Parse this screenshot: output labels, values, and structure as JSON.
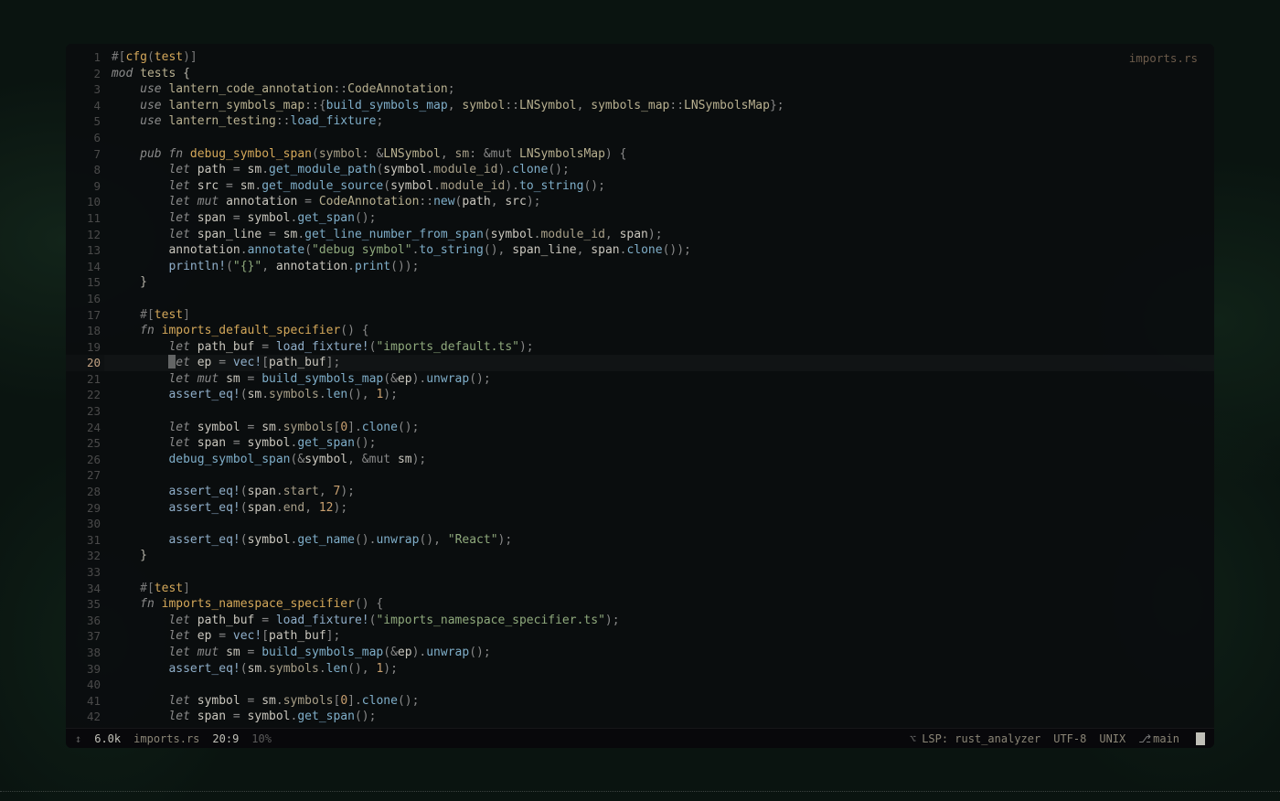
{
  "file": {
    "name": "imports.rs"
  },
  "status": {
    "left": {
      "arrow": "↕",
      "size": "6.0k",
      "filename": "imports.rs",
      "position": "20:9",
      "percent": "10%"
    },
    "center": {
      "prefix": "⌥",
      "lsp": "LSP: rust_analyzer"
    },
    "right": {
      "encoding": "UTF-8",
      "lineending": "UNIX",
      "branch_icon": "⎇",
      "branch": "main"
    }
  },
  "active_line": 20,
  "lines": [
    {
      "n": 1,
      "tokens": [
        [
          "t-attr",
          "#["
        ],
        [
          "t-built",
          "cfg"
        ],
        [
          "t-attr",
          "("
        ],
        [
          "t-built",
          "test"
        ],
        [
          "t-attr",
          ")]"
        ]
      ]
    },
    {
      "n": 2,
      "tokens": [
        [
          "t-kw",
          "mod "
        ],
        [
          "t-type",
          "tests"
        ],
        [
          "t-plain",
          " {"
        ]
      ]
    },
    {
      "n": 3,
      "tokens": [
        [
          "t-kw",
          "    use "
        ],
        [
          "t-path",
          "lantern_code_annotation"
        ],
        [
          "t-op",
          "::"
        ],
        [
          "t-type",
          "CodeAnnotation"
        ],
        [
          "t-punct",
          ";"
        ]
      ]
    },
    {
      "n": 4,
      "tokens": [
        [
          "t-kw",
          "    use "
        ],
        [
          "t-path",
          "lantern_symbols_map"
        ],
        [
          "t-op",
          "::{"
        ],
        [
          "t-func",
          "build_symbols_map"
        ],
        [
          "t-punct",
          ", "
        ],
        [
          "t-path",
          "symbol"
        ],
        [
          "t-op",
          "::"
        ],
        [
          "t-type",
          "LNSymbol"
        ],
        [
          "t-punct",
          ", "
        ],
        [
          "t-path",
          "symbols_map"
        ],
        [
          "t-op",
          "::"
        ],
        [
          "t-type",
          "LNSymbolsMap"
        ],
        [
          "t-punct",
          "};"
        ]
      ]
    },
    {
      "n": 5,
      "tokens": [
        [
          "t-kw",
          "    use "
        ],
        [
          "t-path",
          "lantern_testing"
        ],
        [
          "t-op",
          "::"
        ],
        [
          "t-func",
          "load_fixture"
        ],
        [
          "t-punct",
          ";"
        ]
      ]
    },
    {
      "n": 6,
      "tokens": []
    },
    {
      "n": 7,
      "tokens": [
        [
          "t-kw",
          "    pub fn "
        ],
        [
          "t-funcdef",
          "debug_symbol_span"
        ],
        [
          "t-punct",
          "("
        ],
        [
          "t-param",
          "symbol"
        ],
        [
          "t-punct",
          ": "
        ],
        [
          "t-op",
          "&"
        ],
        [
          "t-type",
          "LNSymbol"
        ],
        [
          "t-punct",
          ", "
        ],
        [
          "t-param",
          "sm"
        ],
        [
          "t-punct",
          ": "
        ],
        [
          "t-op",
          "&mut "
        ],
        [
          "t-type",
          "LNSymbolsMap"
        ],
        [
          "t-punct",
          ") {"
        ]
      ]
    },
    {
      "n": 8,
      "tokens": [
        [
          "t-kw",
          "        let "
        ],
        [
          "t-var",
          "path"
        ],
        [
          "t-op",
          " = "
        ],
        [
          "t-var",
          "sm"
        ],
        [
          "t-punct",
          "."
        ],
        [
          "t-func",
          "get_module_path"
        ],
        [
          "t-punct",
          "("
        ],
        [
          "t-var",
          "symbol"
        ],
        [
          "t-punct",
          "."
        ],
        [
          "t-prop",
          "module_id"
        ],
        [
          "t-punct",
          ")."
        ],
        [
          "t-func",
          "clone"
        ],
        [
          "t-punct",
          "();"
        ]
      ]
    },
    {
      "n": 9,
      "tokens": [
        [
          "t-kw",
          "        let "
        ],
        [
          "t-var",
          "src"
        ],
        [
          "t-op",
          " = "
        ],
        [
          "t-var",
          "sm"
        ],
        [
          "t-punct",
          "."
        ],
        [
          "t-func",
          "get_module_source"
        ],
        [
          "t-punct",
          "("
        ],
        [
          "t-var",
          "symbol"
        ],
        [
          "t-punct",
          "."
        ],
        [
          "t-prop",
          "module_id"
        ],
        [
          "t-punct",
          ")."
        ],
        [
          "t-func",
          "to_string"
        ],
        [
          "t-punct",
          "();"
        ]
      ]
    },
    {
      "n": 10,
      "tokens": [
        [
          "t-kw",
          "        let mut "
        ],
        [
          "t-var",
          "annotation"
        ],
        [
          "t-op",
          " = "
        ],
        [
          "t-type",
          "CodeAnnotation"
        ],
        [
          "t-op",
          "::"
        ],
        [
          "t-func",
          "new"
        ],
        [
          "t-punct",
          "("
        ],
        [
          "t-var",
          "path"
        ],
        [
          "t-punct",
          ", "
        ],
        [
          "t-var",
          "src"
        ],
        [
          "t-punct",
          ");"
        ]
      ]
    },
    {
      "n": 11,
      "tokens": [
        [
          "t-kw",
          "        let "
        ],
        [
          "t-var",
          "span"
        ],
        [
          "t-op",
          " = "
        ],
        [
          "t-var",
          "symbol"
        ],
        [
          "t-punct",
          "."
        ],
        [
          "t-func",
          "get_span"
        ],
        [
          "t-punct",
          "();"
        ]
      ]
    },
    {
      "n": 12,
      "tokens": [
        [
          "t-kw",
          "        let "
        ],
        [
          "t-var",
          "span_line"
        ],
        [
          "t-op",
          " = "
        ],
        [
          "t-var",
          "sm"
        ],
        [
          "t-punct",
          "."
        ],
        [
          "t-func",
          "get_line_number_from_span"
        ],
        [
          "t-punct",
          "("
        ],
        [
          "t-var",
          "symbol"
        ],
        [
          "t-punct",
          "."
        ],
        [
          "t-prop",
          "module_id"
        ],
        [
          "t-punct",
          ", "
        ],
        [
          "t-var",
          "span"
        ],
        [
          "t-punct",
          ");"
        ]
      ]
    },
    {
      "n": 13,
      "tokens": [
        [
          "t-plain",
          "        "
        ],
        [
          "t-var",
          "annotation"
        ],
        [
          "t-punct",
          "."
        ],
        [
          "t-func",
          "annotate"
        ],
        [
          "t-punct",
          "("
        ],
        [
          "t-str",
          "\"debug symbol\""
        ],
        [
          "t-punct",
          "."
        ],
        [
          "t-func",
          "to_string"
        ],
        [
          "t-punct",
          "(), "
        ],
        [
          "t-var",
          "span_line"
        ],
        [
          "t-punct",
          ", "
        ],
        [
          "t-var",
          "span"
        ],
        [
          "t-punct",
          "."
        ],
        [
          "t-func",
          "clone"
        ],
        [
          "t-punct",
          "());"
        ]
      ]
    },
    {
      "n": 14,
      "tokens": [
        [
          "t-plain",
          "        "
        ],
        [
          "t-macro",
          "println!"
        ],
        [
          "t-punct",
          "("
        ],
        [
          "t-str",
          "\"{}\""
        ],
        [
          "t-punct",
          ", "
        ],
        [
          "t-var",
          "annotation"
        ],
        [
          "t-punct",
          "."
        ],
        [
          "t-func",
          "print"
        ],
        [
          "t-punct",
          "());"
        ]
      ]
    },
    {
      "n": 15,
      "tokens": [
        [
          "t-plain",
          "    }"
        ]
      ]
    },
    {
      "n": 16,
      "tokens": []
    },
    {
      "n": 17,
      "tokens": [
        [
          "t-attr",
          "    #["
        ],
        [
          "t-built",
          "test"
        ],
        [
          "t-attr",
          "]"
        ]
      ]
    },
    {
      "n": 18,
      "tokens": [
        [
          "t-kw",
          "    fn "
        ],
        [
          "t-funcdef",
          "imports_default_specifier"
        ],
        [
          "t-punct",
          "() {"
        ]
      ]
    },
    {
      "n": 19,
      "tokens": [
        [
          "t-kw",
          "        let "
        ],
        [
          "t-var",
          "path_buf"
        ],
        [
          "t-op",
          " = "
        ],
        [
          "t-macro",
          "load_fixture!"
        ],
        [
          "t-punct",
          "("
        ],
        [
          "t-str",
          "\"imports_default.ts\""
        ],
        [
          "t-punct",
          ");"
        ]
      ]
    },
    {
      "n": 20,
      "tokens": [
        [
          "t-plain",
          "        "
        ],
        [
          "cursor",
          ""
        ],
        [
          "t-kw",
          "et "
        ],
        [
          "t-var",
          "ep"
        ],
        [
          "t-op",
          " = "
        ],
        [
          "t-macro",
          "vec!"
        ],
        [
          "t-punct",
          "["
        ],
        [
          "t-var",
          "path_buf"
        ],
        [
          "t-punct",
          "];"
        ]
      ]
    },
    {
      "n": 21,
      "tokens": [
        [
          "t-kw",
          "        let mut "
        ],
        [
          "t-var",
          "sm"
        ],
        [
          "t-op",
          " = "
        ],
        [
          "t-func",
          "build_symbols_map"
        ],
        [
          "t-punct",
          "("
        ],
        [
          "t-op",
          "&"
        ],
        [
          "t-var",
          "ep"
        ],
        [
          "t-punct",
          ")."
        ],
        [
          "t-func",
          "unwrap"
        ],
        [
          "t-punct",
          "();"
        ]
      ]
    },
    {
      "n": 22,
      "tokens": [
        [
          "t-plain",
          "        "
        ],
        [
          "t-macro",
          "assert_eq!"
        ],
        [
          "t-punct",
          "("
        ],
        [
          "t-var",
          "sm"
        ],
        [
          "t-punct",
          "."
        ],
        [
          "t-prop",
          "symbols"
        ],
        [
          "t-punct",
          "."
        ],
        [
          "t-func",
          "len"
        ],
        [
          "t-punct",
          "(), "
        ],
        [
          "t-num",
          "1"
        ],
        [
          "t-punct",
          ");"
        ]
      ]
    },
    {
      "n": 23,
      "tokens": []
    },
    {
      "n": 24,
      "tokens": [
        [
          "t-kw",
          "        let "
        ],
        [
          "t-var",
          "symbol"
        ],
        [
          "t-op",
          " = "
        ],
        [
          "t-var",
          "sm"
        ],
        [
          "t-punct",
          "."
        ],
        [
          "t-prop",
          "symbols"
        ],
        [
          "t-punct",
          "["
        ],
        [
          "t-num",
          "0"
        ],
        [
          "t-punct",
          "]."
        ],
        [
          "t-func",
          "clone"
        ],
        [
          "t-punct",
          "();"
        ]
      ]
    },
    {
      "n": 25,
      "tokens": [
        [
          "t-kw",
          "        let "
        ],
        [
          "t-var",
          "span"
        ],
        [
          "t-op",
          " = "
        ],
        [
          "t-var",
          "symbol"
        ],
        [
          "t-punct",
          "."
        ],
        [
          "t-func",
          "get_span"
        ],
        [
          "t-punct",
          "();"
        ]
      ]
    },
    {
      "n": 26,
      "tokens": [
        [
          "t-plain",
          "        "
        ],
        [
          "t-func",
          "debug_symbol_span"
        ],
        [
          "t-punct",
          "("
        ],
        [
          "t-op",
          "&"
        ],
        [
          "t-var",
          "symbol"
        ],
        [
          "t-punct",
          ", "
        ],
        [
          "t-op",
          "&mut "
        ],
        [
          "t-var",
          "sm"
        ],
        [
          "t-punct",
          ");"
        ]
      ]
    },
    {
      "n": 27,
      "tokens": []
    },
    {
      "n": 28,
      "tokens": [
        [
          "t-plain",
          "        "
        ],
        [
          "t-macro",
          "assert_eq!"
        ],
        [
          "t-punct",
          "("
        ],
        [
          "t-var",
          "span"
        ],
        [
          "t-punct",
          "."
        ],
        [
          "t-prop",
          "start"
        ],
        [
          "t-punct",
          ", "
        ],
        [
          "t-num",
          "7"
        ],
        [
          "t-punct",
          ");"
        ]
      ]
    },
    {
      "n": 29,
      "tokens": [
        [
          "t-plain",
          "        "
        ],
        [
          "t-macro",
          "assert_eq!"
        ],
        [
          "t-punct",
          "("
        ],
        [
          "t-var",
          "span"
        ],
        [
          "t-punct",
          "."
        ],
        [
          "t-prop",
          "end"
        ],
        [
          "t-punct",
          ", "
        ],
        [
          "t-num",
          "12"
        ],
        [
          "t-punct",
          ");"
        ]
      ]
    },
    {
      "n": 30,
      "tokens": []
    },
    {
      "n": 31,
      "tokens": [
        [
          "t-plain",
          "        "
        ],
        [
          "t-macro",
          "assert_eq!"
        ],
        [
          "t-punct",
          "("
        ],
        [
          "t-var",
          "symbol"
        ],
        [
          "t-punct",
          "."
        ],
        [
          "t-func",
          "get_name"
        ],
        [
          "t-punct",
          "()."
        ],
        [
          "t-func",
          "unwrap"
        ],
        [
          "t-punct",
          "(), "
        ],
        [
          "t-str",
          "\"React\""
        ],
        [
          "t-punct",
          ");"
        ]
      ]
    },
    {
      "n": 32,
      "tokens": [
        [
          "t-plain",
          "    }"
        ]
      ]
    },
    {
      "n": 33,
      "tokens": []
    },
    {
      "n": 34,
      "tokens": [
        [
          "t-attr",
          "    #["
        ],
        [
          "t-built",
          "test"
        ],
        [
          "t-attr",
          "]"
        ]
      ]
    },
    {
      "n": 35,
      "tokens": [
        [
          "t-kw",
          "    fn "
        ],
        [
          "t-funcdef",
          "imports_namespace_specifier"
        ],
        [
          "t-punct",
          "() {"
        ]
      ]
    },
    {
      "n": 36,
      "tokens": [
        [
          "t-kw",
          "        let "
        ],
        [
          "t-var",
          "path_buf"
        ],
        [
          "t-op",
          " = "
        ],
        [
          "t-macro",
          "load_fixture!"
        ],
        [
          "t-punct",
          "("
        ],
        [
          "t-str",
          "\"imports_namespace_specifier.ts\""
        ],
        [
          "t-punct",
          ");"
        ]
      ]
    },
    {
      "n": 37,
      "tokens": [
        [
          "t-kw",
          "        let "
        ],
        [
          "t-var",
          "ep"
        ],
        [
          "t-op",
          " = "
        ],
        [
          "t-macro",
          "vec!"
        ],
        [
          "t-punct",
          "["
        ],
        [
          "t-var",
          "path_buf"
        ],
        [
          "t-punct",
          "];"
        ]
      ]
    },
    {
      "n": 38,
      "tokens": [
        [
          "t-kw",
          "        let mut "
        ],
        [
          "t-var",
          "sm"
        ],
        [
          "t-op",
          " = "
        ],
        [
          "t-func",
          "build_symbols_map"
        ],
        [
          "t-punct",
          "("
        ],
        [
          "t-op",
          "&"
        ],
        [
          "t-var",
          "ep"
        ],
        [
          "t-punct",
          ")."
        ],
        [
          "t-func",
          "unwrap"
        ],
        [
          "t-punct",
          "();"
        ]
      ]
    },
    {
      "n": 39,
      "tokens": [
        [
          "t-plain",
          "        "
        ],
        [
          "t-macro",
          "assert_eq!"
        ],
        [
          "t-punct",
          "("
        ],
        [
          "t-var",
          "sm"
        ],
        [
          "t-punct",
          "."
        ],
        [
          "t-prop",
          "symbols"
        ],
        [
          "t-punct",
          "."
        ],
        [
          "t-func",
          "len"
        ],
        [
          "t-punct",
          "(), "
        ],
        [
          "t-num",
          "1"
        ],
        [
          "t-punct",
          ");"
        ]
      ]
    },
    {
      "n": 40,
      "tokens": []
    },
    {
      "n": 41,
      "tokens": [
        [
          "t-kw",
          "        let "
        ],
        [
          "t-var",
          "symbol"
        ],
        [
          "t-op",
          " = "
        ],
        [
          "t-var",
          "sm"
        ],
        [
          "t-punct",
          "."
        ],
        [
          "t-prop",
          "symbols"
        ],
        [
          "t-punct",
          "["
        ],
        [
          "t-num",
          "0"
        ],
        [
          "t-punct",
          "]."
        ],
        [
          "t-func",
          "clone"
        ],
        [
          "t-punct",
          "();"
        ]
      ]
    },
    {
      "n": 42,
      "tokens": [
        [
          "t-kw",
          "        let "
        ],
        [
          "t-var",
          "span"
        ],
        [
          "t-op",
          " = "
        ],
        [
          "t-var",
          "symbol"
        ],
        [
          "t-punct",
          "."
        ],
        [
          "t-func",
          "get_span"
        ],
        [
          "t-punct",
          "();"
        ]
      ]
    }
  ]
}
